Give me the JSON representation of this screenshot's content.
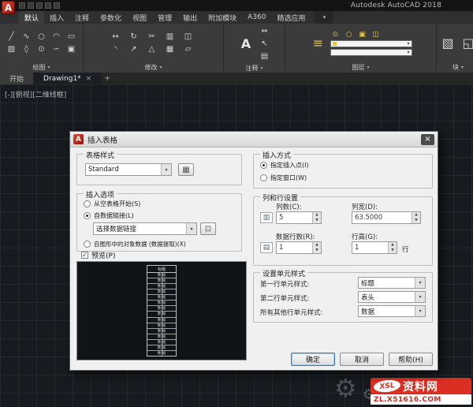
{
  "window": {
    "title": "Autodesk AutoCAD 2018"
  },
  "icons": {
    "app_logo": "A",
    "dropdown": "▾",
    "spin_up": "▲",
    "spin_down": "▼",
    "check": "✓",
    "close": "×",
    "plus": "+",
    "line": "╱",
    "polyline": "∿",
    "circle": "○",
    "arc": "◠",
    "rectangle": "▭",
    "hatch": "▨",
    "ellipse": "◊",
    "point": "⊙",
    "spline": "∽",
    "region": "▣",
    "move": "↔",
    "rotate": "↻",
    "trim": "✂",
    "copy": "▥",
    "mirror": "◫",
    "fillet": "◝",
    "stretch": "↗",
    "scale": "△",
    "array": "▦",
    "erase": "▱",
    "text": "A",
    "dimension": "⇔",
    "leader": "↖",
    "table": "▤",
    "layers": "≡",
    "block": "▧",
    "block2": "◱",
    "columns": "▥",
    "rows": "▤",
    "style_edit": "▦",
    "datalink": "⊡",
    "gear": "⚙"
  },
  "ribbon": {
    "tabs": [
      {
        "label": "默认"
      },
      {
        "label": "插入"
      },
      {
        "label": "注释"
      },
      {
        "label": "参数化"
      },
      {
        "label": "视图"
      },
      {
        "label": "管理"
      },
      {
        "label": "输出"
      },
      {
        "label": "附加模块"
      },
      {
        "label": "A360"
      },
      {
        "label": "精选应用"
      }
    ],
    "panels": {
      "draw": "绘图",
      "modify": "修改",
      "annotate": "注释",
      "layers": "图层",
      "block": "块"
    }
  },
  "file_tabs": {
    "start": "开始",
    "drawing": "Drawing1*"
  },
  "canvas": {
    "viewport_label": "[-][俯视][二维线框]"
  },
  "dialog": {
    "title": "插入表格",
    "style_group": {
      "label": "表格样式",
      "value": "Standard"
    },
    "options_group": {
      "label": "插入选项",
      "empty": "从空表格开始(S)",
      "datalink": "自数据链接(L)",
      "datalink_value": "选择数据链接",
      "object_data": "自图形中的对象数据 (数据提取)(X)"
    },
    "preview_label": "预览(P)",
    "preview": {
      "header": "标题",
      "rows": [
        "数 据",
        "数 据",
        "数 据",
        "数 据",
        "数 据",
        "数 据",
        "数 据",
        "数 据",
        "数 据",
        "数 据",
        "数 据",
        "数 据",
        "数 据",
        "数 据",
        "数 据"
      ]
    },
    "behavior_group": {
      "label": "插入方式",
      "point": "指定插入点(I)",
      "window": "指定窗口(W)"
    },
    "colrow_group": {
      "label": "列和行设置",
      "columns_label": "列数(C):",
      "columns_value": "5",
      "colwidth_label": "列宽(D):",
      "colwidth_value": "63.5000",
      "rows_label": "数据行数(R):",
      "rows_value": "1",
      "rowheight_label": "行高(G):",
      "rowheight_value": "1",
      "rowheight_unit": "行"
    },
    "cellstyle_group": {
      "label": "设置单元样式",
      "first_label": "第一行单元样式:",
      "first_value": "标题",
      "second_label": "第二行单元样式:",
      "second_value": "表头",
      "other_label": "所有其他行单元样式:",
      "other_value": "数据"
    },
    "buttons": {
      "ok": "确定",
      "cancel": "取消",
      "help": "帮助(H)"
    }
  },
  "watermark": {
    "logo": "XSL",
    "brand": "资料网",
    "url": "ZL.X51616.COM"
  }
}
